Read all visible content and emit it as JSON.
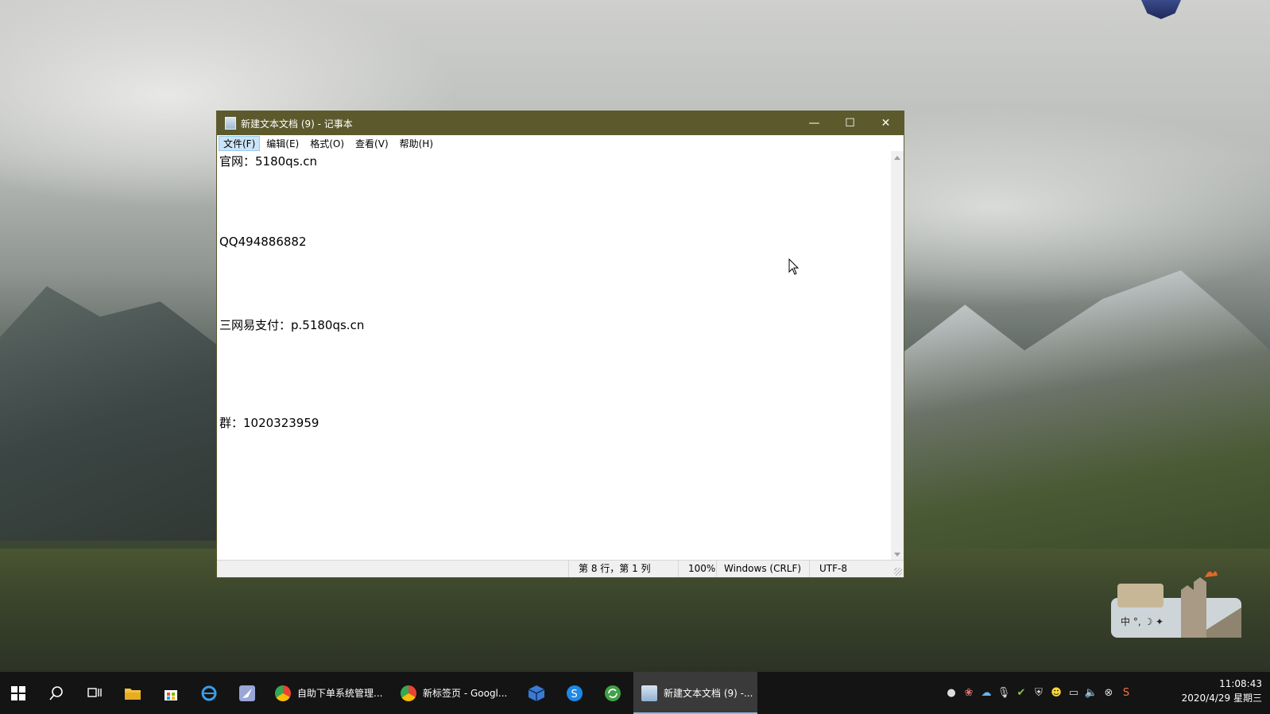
{
  "window": {
    "title": "新建文本文档 (9) - 记事本",
    "controls": {
      "minimize": "—",
      "maximize": "☐",
      "close": "✕"
    }
  },
  "menu": [
    {
      "label": "文件(F)",
      "active": true
    },
    {
      "label": "编辑(E)"
    },
    {
      "label": "格式(O)"
    },
    {
      "label": "查看(V)"
    },
    {
      "label": "帮助(H)"
    }
  ],
  "editor": {
    "lines": [
      "官网：5180qs.cn",
      "QQ494886882",
      "三网易支付：p.5180qs.cn",
      "群：1020323959"
    ]
  },
  "status": {
    "position": "第 8 行，第 1 列",
    "zoom": "100%",
    "line_ending": "Windows (CRLF)",
    "encoding": "UTF-8"
  },
  "taskbar": {
    "apps": [
      {
        "label": "自助下单系统管理...",
        "icon": "chrome-icon"
      },
      {
        "label": "新标签页 - Googl...",
        "icon": "chrome-icon"
      },
      {
        "label": "新建文本文档 (9) -...",
        "icon": "notepad-icon",
        "active": true
      }
    ],
    "clock": {
      "time": "11:08:43",
      "date": "2020/4/29 星期三"
    }
  },
  "colors": {
    "titlebar": "#5c5a2c",
    "taskbar": "#141414",
    "menu_highlight": "#cce4f7"
  }
}
